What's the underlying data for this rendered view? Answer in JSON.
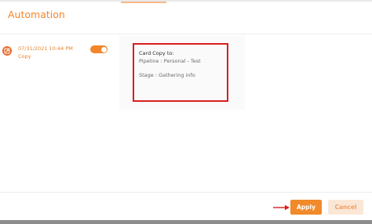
{
  "modal": {
    "title": "Automation"
  },
  "automation_item": {
    "date": "07/31/2021 10:44 PM",
    "action": "Copy",
    "enabled": true
  },
  "detail": {
    "heading": "Card Copy to:",
    "pipeline": "Pipeline : Personal - Test",
    "stage": "Stage : Gathering info"
  },
  "footer": {
    "apply_label": "Apply",
    "cancel_label": "Cancel"
  },
  "colors": {
    "accent": "#f2862a",
    "highlight_box": "#d81e1e",
    "cancel_bg": "#fbe7d6"
  }
}
